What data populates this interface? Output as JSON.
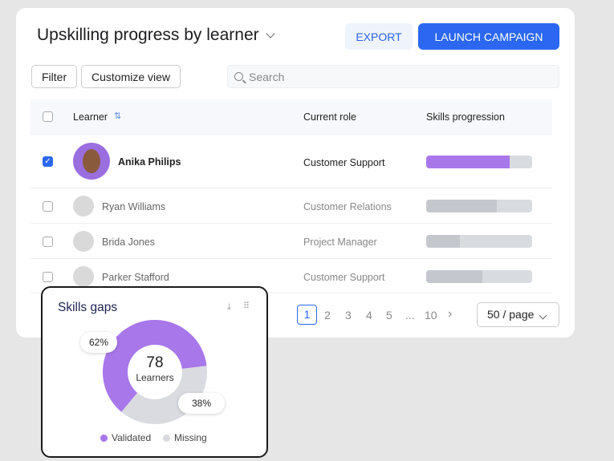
{
  "header": {
    "title": "Upskilling progress by learner",
    "export_label": "EXPORT",
    "launch_label": "LAUNCH CAMPAIGN"
  },
  "toolbar": {
    "filter_label": "Filter",
    "customize_label": "Customize view",
    "search_placeholder": "Search"
  },
  "table": {
    "columns": [
      "Learner",
      "Current role",
      "Skills progression"
    ],
    "rows": [
      {
        "name": "Anika Philips",
        "role": "Customer Support",
        "progress": 79,
        "selected": true
      },
      {
        "name": "Ryan Williams",
        "role": "Customer Relations",
        "progress": 67,
        "selected": false
      },
      {
        "name": "Brida Jones",
        "role": "Project Manager",
        "progress": 32,
        "selected": false
      },
      {
        "name": "Parker Stafford",
        "role": "Customer Support",
        "progress": 53,
        "selected": false
      }
    ]
  },
  "pagination": {
    "pages": [
      "1",
      "2",
      "3",
      "4",
      "5",
      "...",
      "10"
    ],
    "current": "1",
    "per_page": "50 / page"
  },
  "widget": {
    "title": "Skills gaps",
    "center_value": "78",
    "center_label": "Learners",
    "chart_data": {
      "type": "pie",
      "categories": [
        "Validated",
        "Missing"
      ],
      "values": [
        62,
        38
      ],
      "labels": [
        "62%",
        "38%"
      ],
      "colors": [
        "#a877ea",
        "#d9dbe0"
      ],
      "legend": "bottom"
    }
  },
  "colors": {
    "accent": "#2b67f0",
    "progress_selected": "#a877ea",
    "progress_default": "#c4c7cd"
  }
}
